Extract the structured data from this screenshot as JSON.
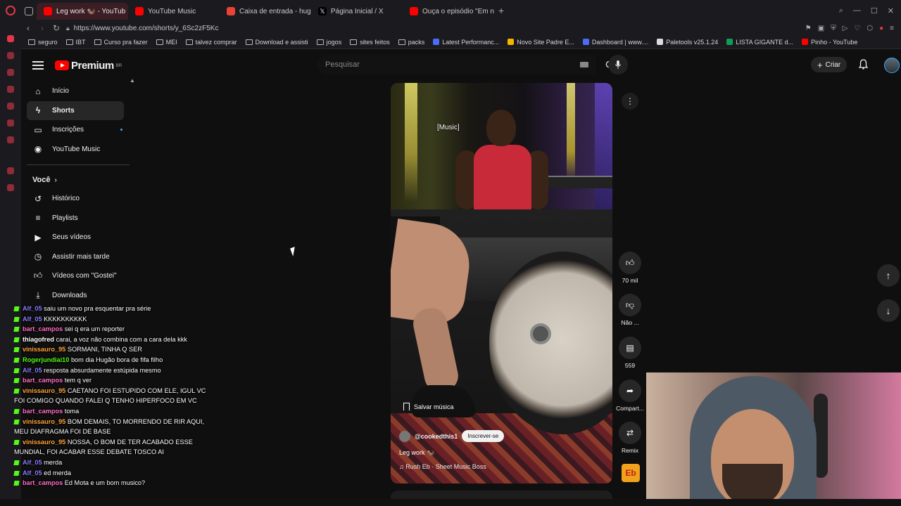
{
  "browser": {
    "tabs": [
      {
        "label": "Leg work 🦦 - YouTub",
        "active": true,
        "color": "#ff0000"
      },
      {
        "label": "YouTube Music",
        "active": false,
        "color": "#ff0000"
      },
      {
        "label": "Caixa de entrada - hugob",
        "active": false,
        "color": "#ea4335"
      },
      {
        "label": "Página Inicial / X",
        "active": false,
        "color": "#000000"
      },
      {
        "label": "Ouça o episódio \"Em nom",
        "active": false,
        "color": "#ff0000"
      }
    ],
    "new_tab": "+",
    "url": "https://www.youtube.com/shorts/y_6Sc2zF5Kc",
    "bookmarks": [
      {
        "label": "seguro",
        "icon": "folder"
      },
      {
        "label": "IBT",
        "icon": "folder"
      },
      {
        "label": "Curso pra fazer",
        "icon": "folder"
      },
      {
        "label": "MEI",
        "icon": "folder"
      },
      {
        "label": "talvez comprar",
        "icon": "folder"
      },
      {
        "label": "Download e assisti",
        "icon": "folder"
      },
      {
        "label": "jogos",
        "icon": "folder"
      },
      {
        "label": "sites feitos",
        "icon": "folder"
      },
      {
        "label": "packs",
        "icon": "folder"
      },
      {
        "label": "Latest Performanc...",
        "icon": "site"
      },
      {
        "label": "Novo Site Padre E...",
        "icon": "drive"
      },
      {
        "label": "Dashboard | www....",
        "icon": "site"
      },
      {
        "label": "Paletools v25.1.24",
        "icon": "doc"
      },
      {
        "label": "LISTA GIGANTE d...",
        "icon": "sheet"
      },
      {
        "label": "Pinho - YouTube",
        "icon": "youtube"
      }
    ]
  },
  "youtube": {
    "logo_text": "Premium",
    "country": "BR",
    "search_placeholder": "Pesquisar",
    "create_label": "Criar",
    "guide_main": [
      {
        "label": "Início",
        "icon": "home-icon",
        "active": false
      },
      {
        "label": "Shorts",
        "icon": "shorts-icon",
        "active": true
      },
      {
        "label": "Inscrições",
        "icon": "subscriptions-icon",
        "active": false
      },
      {
        "label": "YouTube Music",
        "icon": "youtube-music-icon",
        "active": false
      }
    ],
    "you_header": "Você",
    "guide_you": [
      {
        "label": "Histórico",
        "icon": "history-icon"
      },
      {
        "label": "Playlists",
        "icon": "playlists-icon"
      },
      {
        "label": "Seus vídeos",
        "icon": "your-videos-icon"
      },
      {
        "label": "Assistir mais tarde",
        "icon": "watch-later-icon"
      },
      {
        "label": "Vídeos com \"Gostei\"",
        "icon": "liked-icon"
      },
      {
        "label": "Downloads",
        "icon": "download-icon"
      }
    ],
    "short": {
      "caption": "[Music]",
      "save_music": "Salvar música",
      "channel": "@cookedthis1",
      "subscribe": "Inscrever-se",
      "title": "Leg work 🦦",
      "music": "Rush Eb · Sheet Music Boss"
    },
    "actions": {
      "likes": "70 mil",
      "dislike": "Não ...",
      "comments": "559",
      "share": "Compart...",
      "remix": "Remix"
    }
  },
  "chat": [
    {
      "user": "Alf_05",
      "text": "saiu um novo pra esquentar pra série",
      "color": "#8a7cff"
    },
    {
      "user": "Alf_05",
      "text": "KKKKKKKKKK",
      "color": "#8a7cff"
    },
    {
      "user": "bart_campos",
      "text": "sei q era um reporter",
      "color": "#ff6ec7"
    },
    {
      "user": "thiagofred",
      "text": "carai, a voz não combina com a cara dela kkk",
      "color": "#ffffff"
    },
    {
      "user": "vinissauro_95",
      "text": "SORMANI, TINHA Q SER",
      "color": "#ffa23a"
    },
    {
      "user": "Rogerjundiai10",
      "text": "bom dia Hugão bora de fifa filho",
      "color": "#53fc18"
    },
    {
      "user": "Alf_05",
      "text": "resposta absurdamente estúpida mesmo",
      "color": "#8a7cff"
    },
    {
      "user": "bart_campos",
      "text": "tem q ver",
      "color": "#ff6ec7"
    },
    {
      "user": "vinissauro_95",
      "text": "CAETANO FOI ESTUPIDO COM ELE, IGUL VC FOI COMIGO QUANDO FALEI Q TENHO HIPERFOCO EM VC",
      "color": "#ffa23a"
    },
    {
      "user": "bart_campos",
      "text": "toma",
      "color": "#ff6ec7"
    },
    {
      "user": "vinissauro_95",
      "text": "BOM DEMAIS, TO MORRENDO DE RIR AQUI, MEU DIAFRAGMA FOI DE BASE",
      "color": "#ffa23a"
    },
    {
      "user": "vinissauro_95",
      "text": "NOSSA, O BOM DE TER ACABADO ESSE MUNDIAL, FOI ACABAR ESSE DEBATE TOSCO AI",
      "color": "#ffa23a"
    },
    {
      "user": "Alf_05",
      "text": "merda",
      "color": "#8a7cff"
    },
    {
      "user": "Alf_05",
      "text": "ed merda",
      "color": "#8a7cff"
    },
    {
      "user": "bart_campos",
      "text": "Ed Mota e um bom musico?",
      "color": "#ff6ec7"
    }
  ]
}
